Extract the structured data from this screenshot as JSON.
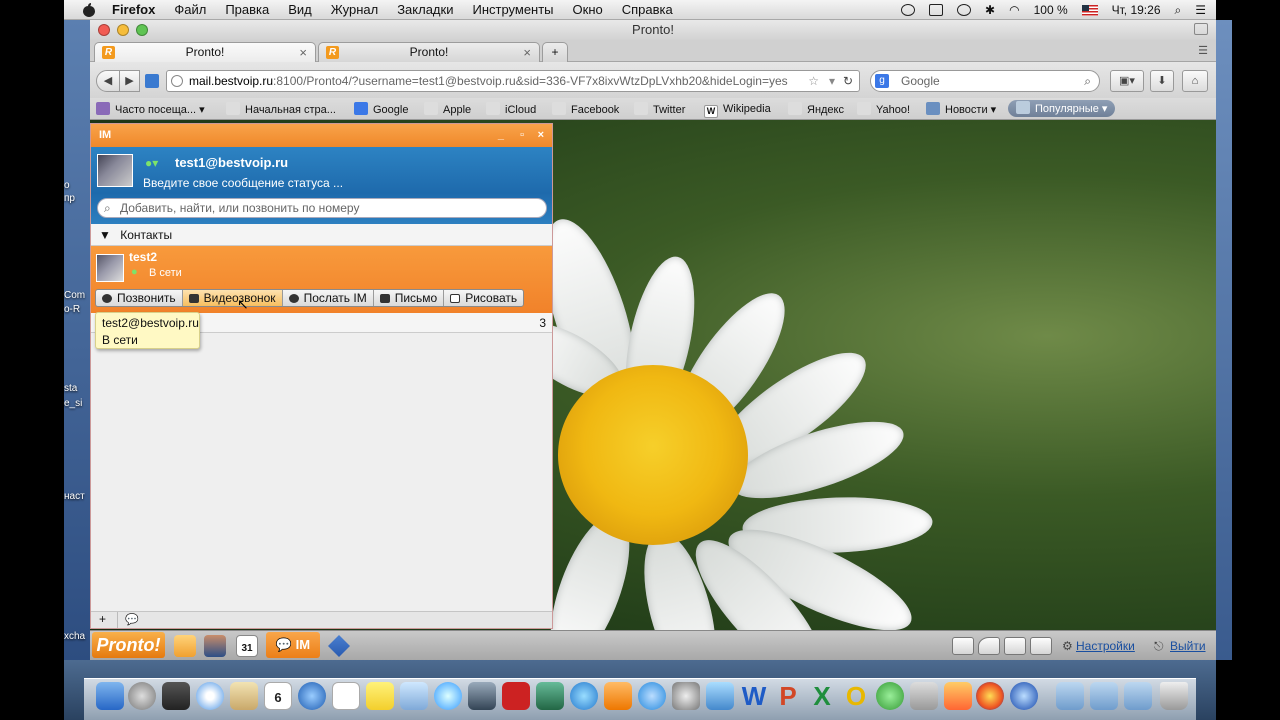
{
  "menubar": {
    "app": "Firefox",
    "items": [
      "Файл",
      "Правка",
      "Вид",
      "Журнал",
      "Закладки",
      "Инструменты",
      "Окно",
      "Справка"
    ],
    "battery": "100 %",
    "clock": "Чт, 19:26"
  },
  "window": {
    "title": "Pronto!"
  },
  "tabs": [
    {
      "label": "Pronto!"
    },
    {
      "label": "Pronto!"
    }
  ],
  "url": {
    "host": "mail.bestvoip.ru",
    "rest": ":8100/Pronto4/?username=test1@bestvoip.ru&sid=336-VF7x8ixvWtzDpLVxhb20&hideLogin=yes"
  },
  "search": {
    "placeholder": "Google"
  },
  "bookmarks": [
    "Часто посеща...",
    "Начальная стра...",
    "Google",
    "Apple",
    "iCloud",
    "Facebook",
    "Twitter",
    "Wikipedia",
    "Яндекс",
    "Yahoo!",
    "Новости",
    "Популярные"
  ],
  "desktop_fragments": [
    "о",
    "пр",
    "Com",
    "o-R",
    "sta",
    "e_si",
    "наст",
    "xcha"
  ],
  "im": {
    "title": "IM",
    "username": "test1@bestvoip.ru",
    "status_message": "Введите свое сообщение статуса ...",
    "search_placeholder": "Добавить, найти, или позвонить по номеру",
    "contacts_header": "Контакты",
    "contact": {
      "name": "test2",
      "status": "В сети"
    },
    "actions": [
      "Позвонить",
      "Видеозвонок",
      "Послать IM",
      "Письмо",
      "Рисовать"
    ],
    "group_count": "3",
    "tooltip": {
      "line1": "test2@bestvoip.ru",
      "line2": "В сети"
    },
    "footer_add": "+"
  },
  "pronto_bar": {
    "logo": "Pronto!",
    "im_label": "IM",
    "calendar_day": "31",
    "settings": "Настройки",
    "logout": "Выйти"
  },
  "dock": {
    "calendar_day": "6",
    "icons": [
      "finder",
      "launchpad",
      "mission-control",
      "safari",
      "mail",
      "calendar",
      "thunderbird",
      "notes",
      "stickies",
      "preview",
      "messages",
      "facetime",
      "photo-booth",
      "iphoto",
      "itunes",
      "ibooks",
      "app-store",
      "system-preferences",
      "pages-w",
      "powerpoint",
      "excel",
      "outlook",
      "network",
      "skype",
      "firefox",
      "opera",
      "downloads",
      "applications",
      "documents",
      "trash"
    ]
  },
  "colors": {
    "accent": "#f0882a",
    "im_header": "#1e6aac",
    "link": "#1a4fa0"
  }
}
